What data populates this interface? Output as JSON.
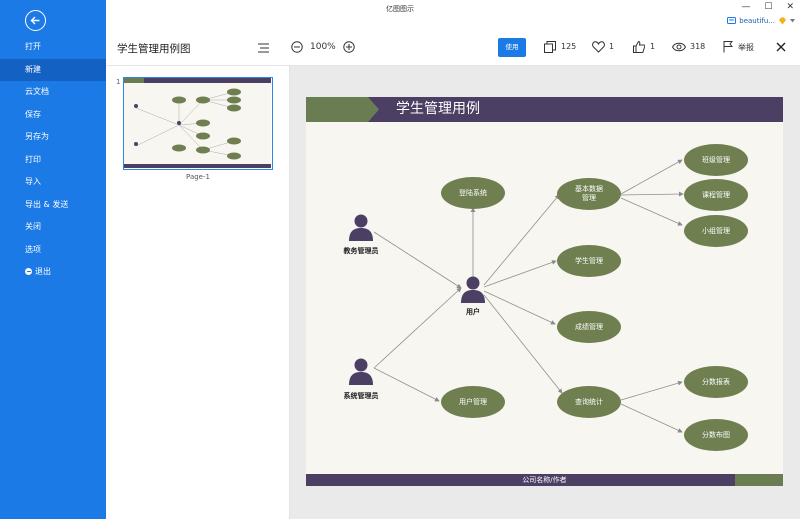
{
  "app_title": "亿图图示",
  "window_controls": {
    "minimize": "—",
    "maximize": "☐",
    "close": "✕"
  },
  "user": {
    "name": "beautifu...",
    "badge_icon": "diamond-icon"
  },
  "sidebar": {
    "items": [
      {
        "label": "打开"
      },
      {
        "label": "新建",
        "active": true
      },
      {
        "label": "云文档"
      },
      {
        "label": "保存"
      },
      {
        "label": "另存为"
      },
      {
        "label": "打印"
      },
      {
        "label": "导入"
      },
      {
        "label": "导出 & 发送"
      },
      {
        "label": "关闭"
      },
      {
        "label": "选项"
      },
      {
        "label": "退出"
      }
    ]
  },
  "toolbar": {
    "doc_title": "学生管理用例图",
    "zoom": "100%",
    "use_label": "使用",
    "copies": "125",
    "likes": "1",
    "thumbs": "1",
    "views": "318",
    "report": "举报"
  },
  "pages": {
    "number": "1",
    "label": "Page-1"
  },
  "diagram": {
    "title": "学生管理用例",
    "footer": "公司名称/作者",
    "actors": {
      "a1": "教务管理员",
      "a2": "系统管理员",
      "a3": "用户"
    },
    "nodes": {
      "login": "登陆系统",
      "basic": [
        "基本数据",
        "管理"
      ],
      "student": "学生管理",
      "grades": "成绩管理",
      "query": "查询统计",
      "usermgmt": "用户管理",
      "class": "班级管理",
      "course": "课程管理",
      "group": "小组管理",
      "report": "分数报表",
      "dist": "分数布图"
    },
    "colors": {
      "node": "#6f7f50",
      "band": "#4b3f63",
      "accent": "#6a7c52",
      "actor": "#4b3f63"
    }
  }
}
